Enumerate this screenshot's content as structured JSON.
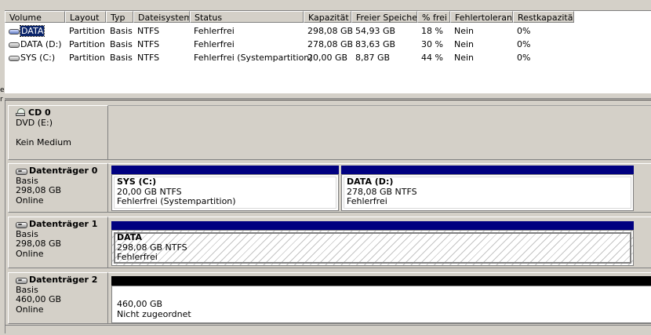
{
  "left_fragments": [
    "e",
    "r"
  ],
  "columns": [
    "Volume",
    "Layout",
    "Typ",
    "Dateisystem",
    "Status",
    "Kapazität",
    "Freier Speicher",
    "% frei",
    "Fehlertoleranz",
    "Restkapazität"
  ],
  "volumes": [
    {
      "name": "DATA",
      "layout": "Partition",
      "type": "Basis",
      "fs": "NTFS",
      "status": "Fehlerfrei",
      "capacity": "298,08 GB",
      "free": "54,93 GB",
      "pct": "18 %",
      "fault": "Nein",
      "overhead": "0%",
      "selected": true
    },
    {
      "name": "DATA (D:)",
      "layout": "Partition",
      "type": "Basis",
      "fs": "NTFS",
      "status": "Fehlerfrei",
      "capacity": "278,08 GB",
      "free": "83,63 GB",
      "pct": "30 %",
      "fault": "Nein",
      "overhead": "0%",
      "selected": false
    },
    {
      "name": "SYS (C:)",
      "layout": "Partition",
      "type": "Basis",
      "fs": "NTFS",
      "status": "Fehlerfrei (Systempartition)",
      "capacity": "20,00 GB",
      "free": "8,87 GB",
      "pct": "44 %",
      "fault": "Nein",
      "overhead": "0%",
      "selected": false
    }
  ],
  "cd": {
    "title": "CD 0",
    "drive": "DVD (E:)",
    "media": "Kein Medium"
  },
  "disks": [
    {
      "title": "Datenträger 0",
      "type": "Basis",
      "size": "298,08 GB",
      "state": "Online",
      "partitions": [
        {
          "name": "SYS  (C:)",
          "size": "20,00 GB NTFS",
          "status": "Fehlerfrei (Systempartition)"
        },
        {
          "name": "DATA  (D:)",
          "size": "278,08 GB NTFS",
          "status": "Fehlerfrei"
        }
      ]
    },
    {
      "title": "Datenträger 1",
      "type": "Basis",
      "size": "298,08 GB",
      "state": "Online",
      "partitions": [
        {
          "name": "DATA",
          "size": "298,08 GB NTFS",
          "status": "Fehlerfrei"
        }
      ]
    },
    {
      "title": "Datenträger 2",
      "type": "Basis",
      "size": "460,00 GB",
      "state": "Online",
      "unallocated": {
        "size": "460,00 GB",
        "status": "Nicht zugeordnet"
      }
    }
  ],
  "colors": {
    "primary_partition": "#000080",
    "unallocated": "#000000",
    "selection": "#0a246a"
  }
}
